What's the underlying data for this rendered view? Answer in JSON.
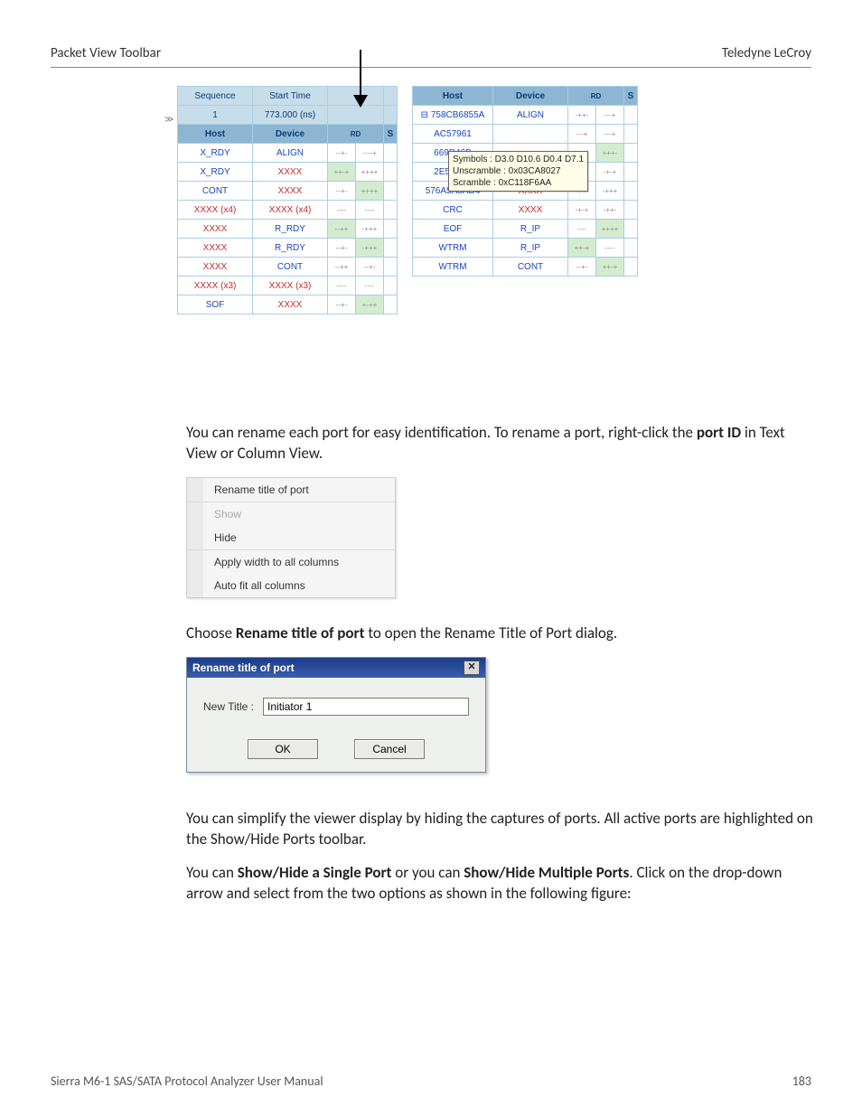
{
  "header": {
    "left": "Packet View Toolbar",
    "right": "Teledyne LeCroy"
  },
  "footer": {
    "left": "Sierra M6-1 SAS/SATA Protocol Analyzer User Manual",
    "right": "183"
  },
  "packet_view": {
    "left": {
      "top_headers": [
        "Sequence",
        "Start Time"
      ],
      "top_values": [
        "1",
        "773.000 (ns)"
      ],
      "col_headers": [
        "Host",
        "Device",
        "RD",
        "S"
      ],
      "rows": [
        {
          "host": "X_RDY",
          "host_cls": "blue",
          "device": "ALIGN",
          "dev_cls": "blue",
          "rd1": "--+-",
          "rd2": "----+"
        },
        {
          "host": "X_RDY",
          "host_cls": "blue",
          "device": "XXXX",
          "dev_cls": "red",
          "rd1": "++-+",
          "rd2": "++++",
          "grn": true
        },
        {
          "host": "CONT",
          "host_cls": "blue",
          "device": "XXXX",
          "dev_cls": "red",
          "rd1": "--+-",
          "rd2": "++++",
          "grn2": true
        },
        {
          "host": "XXXX (x4)",
          "host_cls": "red",
          "device": "XXXX (x4)",
          "dev_cls": "red",
          "rd1": "----",
          "rd2": "----"
        },
        {
          "host": "XXXX",
          "host_cls": "red",
          "device": "R_RDY",
          "dev_cls": "blue",
          "rd1": "--++",
          "rd2": "-+++",
          "grn": true
        },
        {
          "host": "XXXX",
          "host_cls": "red",
          "device": "R_RDY",
          "dev_cls": "blue",
          "rd1": "--+-",
          "rd2": "-+++",
          "grn2": true
        },
        {
          "host": "XXXX",
          "host_cls": "red",
          "device": "CONT",
          "dev_cls": "blue",
          "rd1": "--++",
          "rd2": "--+-"
        },
        {
          "host": "XXXX (x3)",
          "host_cls": "red",
          "device": "XXXX (x3)",
          "dev_cls": "red",
          "rd1": "----",
          "rd2": "----"
        },
        {
          "host": "SOF",
          "host_cls": "blue",
          "device": "XXXX",
          "dev_cls": "red",
          "rd1": "--+-",
          "rd2": "+-++",
          "grn2": true
        }
      ]
    },
    "right": {
      "col_headers": [
        "Host",
        "Device",
        "RD",
        "S"
      ],
      "rows": [
        {
          "host": "758CB6855A",
          "prefix": "⊟",
          "host_cls": "blue",
          "device": "ALIGN",
          "dev_cls": "blue",
          "rd1": "-++-",
          "rd2": "---+"
        },
        {
          "host": "AC57961",
          "host_cls": "blue",
          "device": "",
          "dev_cls": "",
          "rd1": "---+",
          "rd2": "---+"
        },
        {
          "host": "669D46B",
          "host_cls": "blue",
          "device": "",
          "dev_cls": "red",
          "rd1": "",
          "rd2": "+++-",
          "grn2": true
        },
        {
          "host": "2E535C9",
          "host_cls": "blue",
          "device": "XXXX",
          "dev_cls": "red",
          "rd1": "",
          "rd2": "-+-+"
        },
        {
          "host": "576A5A8AD4",
          "host_cls": "blue",
          "device": "XXXX",
          "dev_cls": "red",
          "rd1": "-++-",
          "rd2": "-+++"
        },
        {
          "host": "CRC",
          "host_cls": "blue",
          "device": "XXXX",
          "dev_cls": "red",
          "rd1": "-+-+",
          "rd2": "-++-"
        },
        {
          "host": "EOF",
          "host_cls": "blue",
          "device": "R_IP",
          "dev_cls": "blue",
          "rd1": "----",
          "rd2": "++++",
          "grn2": true
        },
        {
          "host": "WTRM",
          "host_cls": "blue",
          "device": "R_IP",
          "dev_cls": "blue",
          "rd1": "++-+",
          "rd2": "----",
          "grn": true
        },
        {
          "host": "WTRM",
          "host_cls": "blue",
          "device": "CONT",
          "dev_cls": "blue",
          "rd1": "--+-",
          "rd2": "++-+",
          "grn2": true
        }
      ]
    },
    "tooltip": {
      "line1": "Symbols : D3.0 D10.6 D0.4 D7.1",
      "line2": "Unscramble : 0x03CA8027",
      "line3": "Scramble : 0xC118F6AA"
    }
  },
  "paragraphs": {
    "p1a": "You can rename each port for easy identification. To rename a port, right-click the ",
    "p1b": "port ID",
    "p1c": " in Text View or Column View.",
    "p2a": "Choose ",
    "p2b": "Rename title of port",
    "p2c": " to open the Rename Title of Port dialog.",
    "p3": "You can simplify the viewer display by hiding the captures of ports. All active ports are highlighted on the Show/Hide Ports toolbar.",
    "p4a": "You can ",
    "p4b": "Show/Hide a Single Port",
    "p4c": " or you can ",
    "p4d": "Show/Hide Multiple Ports",
    "p4e": ". Click on the drop-down arrow and select from the two options as shown in the following figure:"
  },
  "context_menu": {
    "items": [
      {
        "label": "Rename title of port",
        "enabled": true
      },
      {
        "label": "Show",
        "enabled": false
      },
      {
        "label": "Hide",
        "enabled": true
      },
      {
        "label": "Apply width to all columns",
        "enabled": true
      },
      {
        "label": "Auto fit all columns",
        "enabled": true
      }
    ]
  },
  "dialog": {
    "title": "Rename title of port",
    "field_label": "New Title :",
    "field_value": "Initiator 1",
    "ok": "OK",
    "cancel": "Cancel",
    "close_glyph": "✕"
  }
}
